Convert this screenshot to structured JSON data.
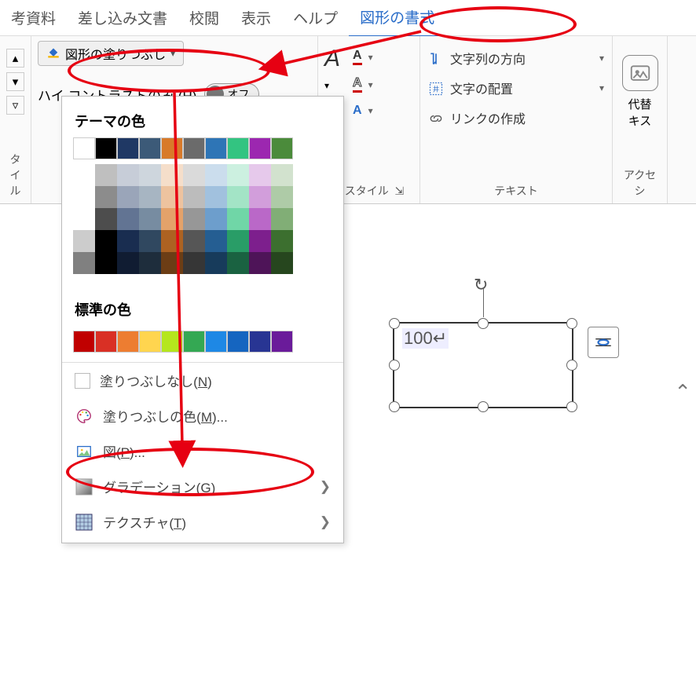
{
  "tabs": {
    "ref": "考資料",
    "mail": "差し込み文書",
    "review": "校閲",
    "view": "表示",
    "help": "ヘルプ",
    "shapeFormat": "図形の書式"
  },
  "ribbon": {
    "styleLabel": "タイル",
    "fillButton": "図形の塗りつぶし",
    "highContrast": "ハイ コントラストのみ (",
    "highContrastKey": "H",
    "highContrastClose": ")",
    "toggleOff": "オフ",
    "wordartStyle": "のスタイル",
    "textDirection": "文字列の方向",
    "textAlign": "文字の配置",
    "createLink": "リンクの作成",
    "textGroup": "テキスト",
    "accGroup": "アクセシ",
    "accBtn1": "代替",
    "accBtn2": "キス"
  },
  "dropdown": {
    "themeColors": "テーマの色",
    "standardColors": "標準の色",
    "noFill": "塗りつぶしなし(",
    "noFillKey": "N",
    "moreColors": "塗りつぶしの色(",
    "moreColorsKey": "M",
    "moreColorsDots": ")...",
    "picture": "図(",
    "pictureKey": "P",
    "pictureDots": ")...",
    "gradient": "グラデーション(",
    "gradientKey": "G",
    "texture": "テクスチャ(",
    "textureKey": "T",
    "closeParen": ")",
    "themeRow": [
      "#ffffff",
      "#000000",
      "#1f3864",
      "#3c5a78",
      "#d87a2a",
      "#6b6b6b",
      "#2e75b6",
      "#33c481",
      "#9c27b0",
      "#4b8b3b"
    ],
    "stdRow": [
      "#c00000",
      "#d93025",
      "#ed7d31",
      "#ffd54f",
      "#b5e61d",
      "#34a853",
      "#1e88e5",
      "#1565c0",
      "#283593",
      "#6a1b9a"
    ]
  },
  "shape": {
    "text": "100"
  }
}
